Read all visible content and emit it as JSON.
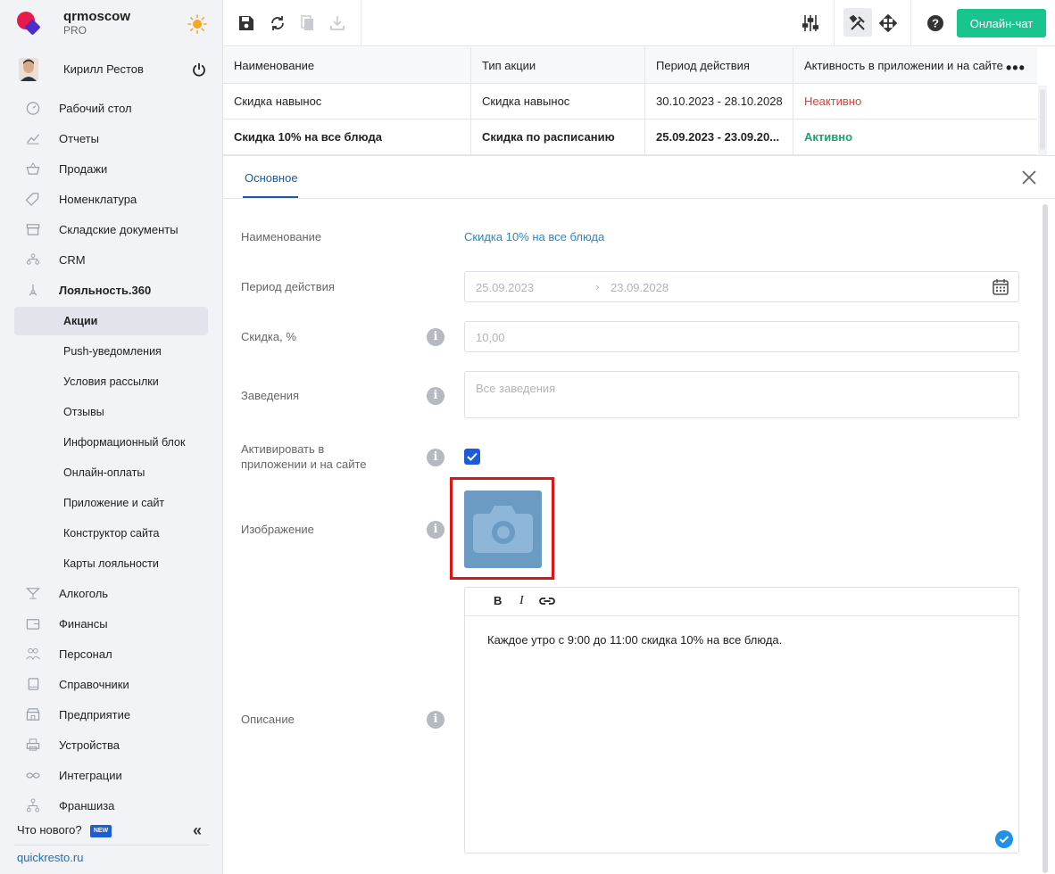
{
  "brand": {
    "org": "qrmoscow",
    "plan": "PRO"
  },
  "user": {
    "name": "Кирилл Рестов"
  },
  "sidebar": {
    "items": [
      {
        "label": "Рабочий стол",
        "icon": "gauge-icon"
      },
      {
        "label": "Отчеты",
        "icon": "chart-icon"
      },
      {
        "label": "Продажи",
        "icon": "basket-icon"
      },
      {
        "label": "Номенклатура",
        "icon": "tag-icon"
      },
      {
        "label": "Складские документы",
        "icon": "archive-icon"
      },
      {
        "label": "CRM",
        "icon": "people-icon"
      },
      {
        "label": "Лояльность.360",
        "icon": "loyalty-icon"
      }
    ],
    "subitems": [
      {
        "label": "Акции"
      },
      {
        "label": "Push-уведомления"
      },
      {
        "label": "Условия рассылки"
      },
      {
        "label": "Отзывы"
      },
      {
        "label": "Информационный блок"
      },
      {
        "label": "Онлайн-оплаты"
      },
      {
        "label": "Приложение и сайт"
      },
      {
        "label": "Конструктор сайта"
      },
      {
        "label": "Карты лояльности"
      }
    ],
    "items2": [
      {
        "label": "Алкоголь",
        "icon": "glass-icon"
      },
      {
        "label": "Финансы",
        "icon": "wallet-icon"
      },
      {
        "label": "Персонал",
        "icon": "staff-icon"
      },
      {
        "label": "Справочники",
        "icon": "book-icon"
      },
      {
        "label": "Предприятие",
        "icon": "store-icon"
      },
      {
        "label": "Устройства",
        "icon": "printer-icon"
      },
      {
        "label": "Интеграции",
        "icon": "infinity-icon"
      },
      {
        "label": "Франшиза",
        "icon": "hierarchy-icon"
      }
    ],
    "whats_new": "Что нового?",
    "new_badge": "NEW",
    "site_link": "quickresto.ru"
  },
  "toolbar": {
    "chat_label": "Онлайн-чат"
  },
  "table": {
    "columns": [
      "Наименование",
      "Тип акции",
      "Период действия",
      "Активность в приложении и на сайте"
    ],
    "rows": [
      {
        "name": "Скидка навынос",
        "type": "Скидка навынос",
        "period": "30.10.2023 - 28.10.2028",
        "status": "Неактивно"
      },
      {
        "name": "Скидка 10% на все блюда",
        "type": "Скидка по расписанию",
        "period": "25.09.2023 - 23.09.20...",
        "status": "Активно"
      }
    ]
  },
  "form": {
    "tab": "Основное",
    "name_label": "Наименование",
    "name_value": "Скидка 10% на все блюда",
    "period_label": "Период действия",
    "period_from": "25.09.2023",
    "period_arrow": "›",
    "period_to": "23.09.2028",
    "discount_label": "Скидка, %",
    "discount_value": "10,00",
    "venues_label": "Заведения",
    "venues_placeholder": "Все заведения",
    "activate_label": "Активировать в приложении и на сайте",
    "activate_checked": true,
    "image_label": "Изображение",
    "description_label": "Описание",
    "description_text": "Каждое утро с 9:00 до 11:00 скидка 10% на все блюда.",
    "editor_bold": "B",
    "editor_italic": "I"
  },
  "colors": {
    "accent": "#1a5aa8",
    "chat": "#18c58f",
    "inactive": "#d9443a",
    "active": "#18a36d",
    "highlight": "#e01414"
  }
}
